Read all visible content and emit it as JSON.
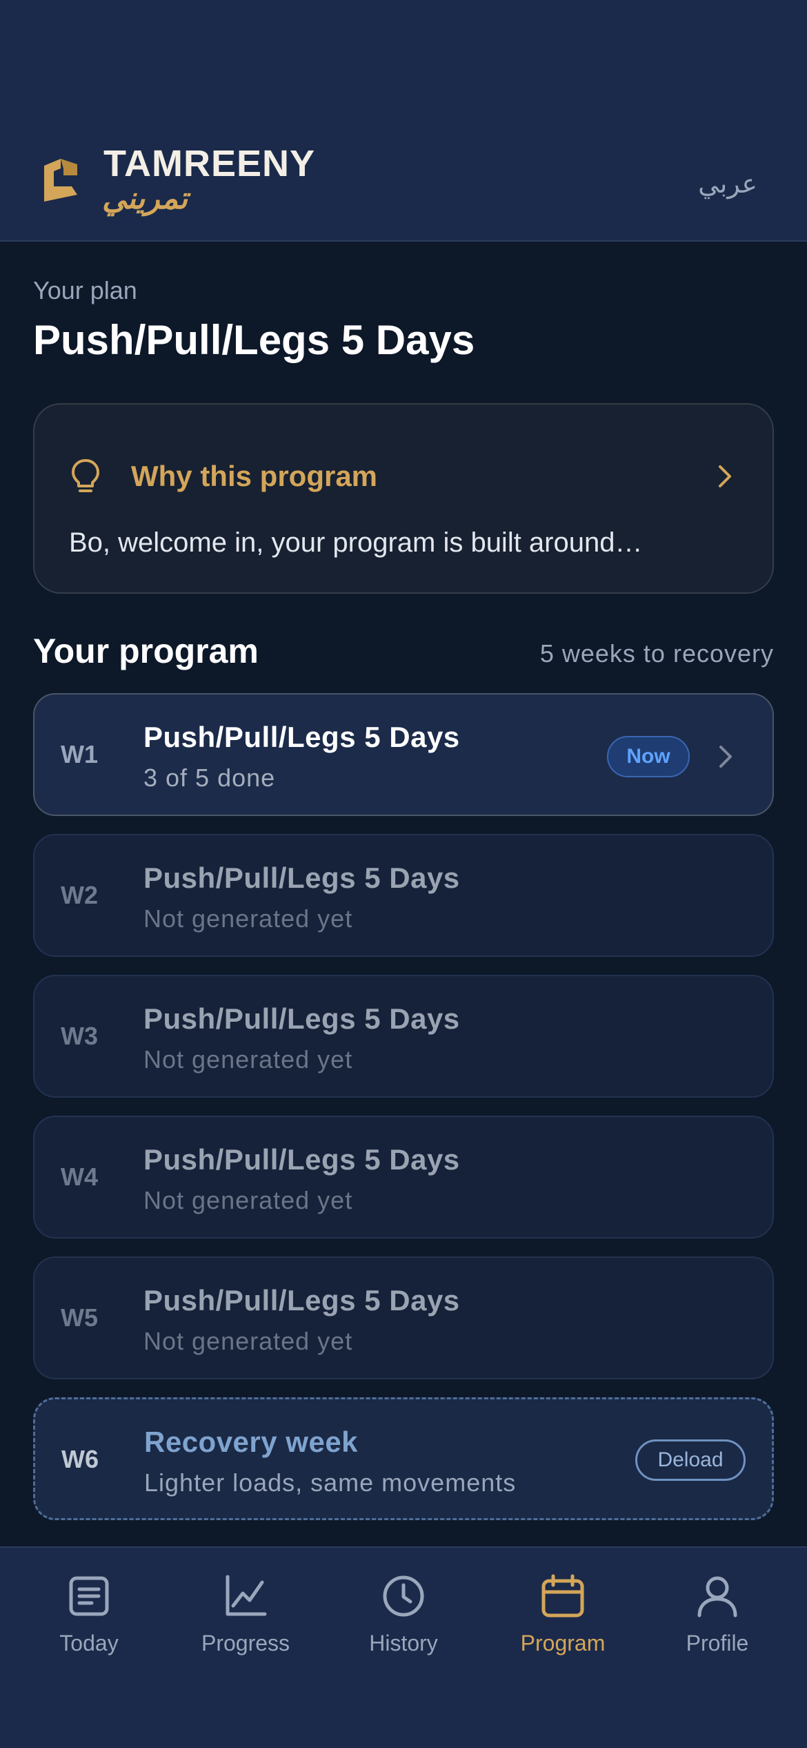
{
  "header": {
    "brand_en": "TAMREENY",
    "brand_ar": "تمريني",
    "language_toggle": "عربي"
  },
  "plan": {
    "subtitle": "Your plan",
    "title": "Push/Pull/Legs 5 Days"
  },
  "why_card": {
    "title": "Why this program",
    "preview": "Bo, welcome in, your program is built around…"
  },
  "program": {
    "title": "Your program",
    "meta": "5 weeks to recovery",
    "weeks": [
      {
        "label": "W1",
        "name": "Push/Pull/Legs 5 Days",
        "status": "3 of 5 done",
        "badge": "Now"
      },
      {
        "label": "W2",
        "name": "Push/Pull/Legs 5 Days",
        "status": "Not generated yet"
      },
      {
        "label": "W3",
        "name": "Push/Pull/Legs 5 Days",
        "status": "Not generated yet"
      },
      {
        "label": "W4",
        "name": "Push/Pull/Legs 5 Days",
        "status": "Not generated yet"
      },
      {
        "label": "W5",
        "name": "Push/Pull/Legs 5 Days",
        "status": "Not generated yet"
      },
      {
        "label": "W6",
        "name": "Recovery week",
        "status": "Lighter loads, same movements",
        "badge": "Deload"
      }
    ]
  },
  "nav": {
    "items": [
      {
        "label": "Today",
        "icon": "document-icon"
      },
      {
        "label": "Progress",
        "icon": "chart-icon"
      },
      {
        "label": "History",
        "icon": "clock-icon"
      },
      {
        "label": "Program",
        "icon": "calendar-icon",
        "active": true
      },
      {
        "label": "Profile",
        "icon": "person-icon"
      }
    ]
  },
  "colors": {
    "accent": "#d4a65a",
    "header_bg": "#1b2a4a",
    "page_bg": "#0d1829",
    "badge_now": "#5fa2ff"
  }
}
